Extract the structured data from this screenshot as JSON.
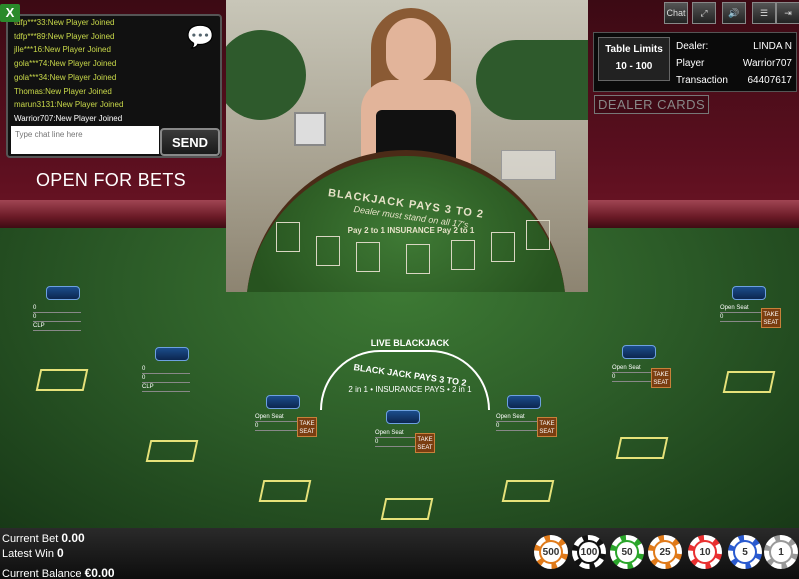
{
  "chat": {
    "close_label": "X",
    "messages": [
      "tdfp***33:New Player Joined",
      "tdfp***89:New Player Joined",
      "jlle***16:New Player Joined",
      "gola***74:New Player Joined",
      "gola***34:New Player Joined",
      "Thomas:New Player Joined",
      "marun3131:New Player Joined",
      "Warrior707:New Player Joined"
    ],
    "input_placeholder": "Type chat line here",
    "send_label": "SEND"
  },
  "status_text": "OPEN FOR BETS",
  "toolbar": {
    "chat_label": "Chat",
    "icons": [
      "chat-icon",
      "fullscreen-icon",
      "sound-icon",
      "menu-icon",
      "exit-icon"
    ]
  },
  "table_info": {
    "limits_title": "Table Limits",
    "limits_value": "10 - 100",
    "dealer_key": "Dealer:",
    "dealer_value": "LINDA N",
    "player_key": "Player",
    "player_value": "Warrior707",
    "transaction_key": "Transaction",
    "transaction_value": "64407617"
  },
  "dealer_cards_label": "DEALER CARDS",
  "video": {
    "pays_text": "BLACKJACK PAYS 3 TO 2",
    "stand_text": "Dealer must stand on all 17's",
    "insurance_text": "Pay 2 to 1   INSURANCE   Pay 2 to 1"
  },
  "seats": [
    {
      "line1": "0",
      "line2": "0",
      "line3": "CLP"
    },
    {
      "line1": "0",
      "line2": "0",
      "line3": "CLP"
    },
    {
      "line1": "Open Seat",
      "line2": "0",
      "take": "TAKE SEAT"
    },
    {
      "line1": "Open Seat",
      "line2": "0",
      "take": "TAKE SEAT"
    },
    {
      "line1": "Open Seat",
      "line2": "0",
      "take": "TAKE SEAT"
    },
    {
      "line1": "Open Seat",
      "line2": "0",
      "take": "TAKE SEAT"
    },
    {
      "line1": "Open Seat",
      "line2": "0",
      "take": "TAKE SEAT"
    }
  ],
  "table_logo": {
    "title": "LIVE BLACKJACK",
    "pays": "BLACK JACK PAYS 3 TO 2",
    "insurance": "2 in 1 • INSURANCE PAYS • 2 in 1"
  },
  "bottom": {
    "current_bet_label": "Current Bet",
    "current_bet_value": "0.00",
    "latest_win_label": "Latest Win",
    "latest_win_value": "0",
    "balance_label": "Current Balance",
    "balance_value": "€0.00"
  },
  "chips": [
    {
      "value": "500",
      "color": "#e07a1a"
    },
    {
      "value": "100",
      "color": "#111111"
    },
    {
      "value": "50",
      "color": "#2aa52a"
    },
    {
      "value": "25",
      "color": "#e07a1a"
    },
    {
      "value": "10",
      "color": "#e83030"
    },
    {
      "value": "5",
      "color": "#2a5acf"
    },
    {
      "value": "1",
      "color": "#999999"
    }
  ]
}
